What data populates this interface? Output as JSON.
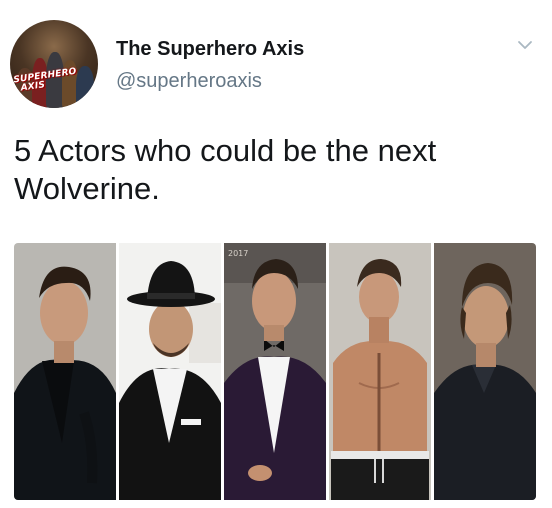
{
  "account": {
    "display_name": "The Superhero Axis",
    "handle": "@superheroaxis",
    "avatar_text_line1": "SUPERHERO",
    "avatar_text_line2": "AXIS"
  },
  "tweet": {
    "text": "5 Actors who could be the next Wolverine."
  },
  "media": {
    "photos": [
      {
        "name": "actor-photo-1",
        "background": "#b9b7b2",
        "outfit": "#101418"
      },
      {
        "name": "actor-photo-2",
        "background": "#f2f2f0",
        "outfit": "#121212"
      },
      {
        "name": "actor-photo-3",
        "background": "#6f6a66",
        "outfit": "#2a1a35",
        "watermark_text": "2017"
      },
      {
        "name": "actor-photo-4",
        "background": "#c8c4bd",
        "outfit": "#1a1a1a"
      },
      {
        "name": "actor-photo-5",
        "background": "#6e655d",
        "outfit": "#1b1e24"
      }
    ]
  },
  "colors": {
    "text_primary": "#14171a",
    "text_secondary": "#657786",
    "chevron": "#aab8c2"
  },
  "icons": {
    "menu": "chevron-down-icon"
  }
}
